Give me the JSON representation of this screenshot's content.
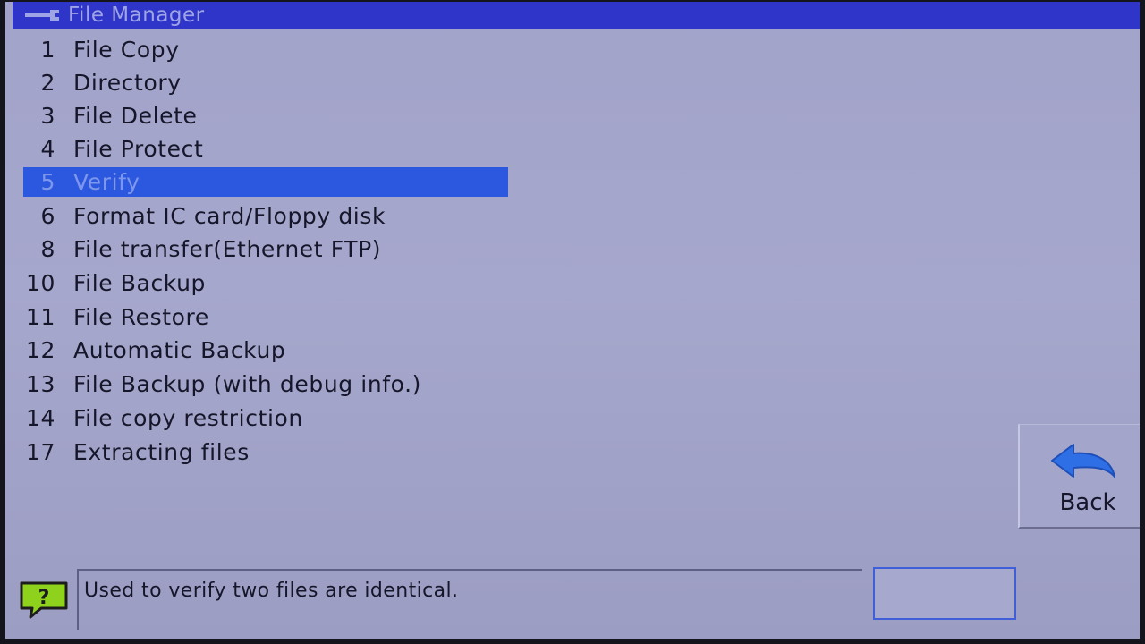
{
  "window": {
    "title": "File Manager",
    "icon": "wrench-icon"
  },
  "menu": {
    "items": [
      {
        "num": "1",
        "label": "File Copy",
        "selected": false
      },
      {
        "num": "2",
        "label": "Directory",
        "selected": false
      },
      {
        "num": "3",
        "label": "File Delete",
        "selected": false
      },
      {
        "num": "4",
        "label": "File Protect",
        "selected": false
      },
      {
        "num": "5",
        "label": "Verify",
        "selected": true
      },
      {
        "num": "6",
        "label": "Format IC card/Floppy disk",
        "selected": false
      },
      {
        "num": "8",
        "label": "File transfer(Ethernet FTP)",
        "selected": false
      },
      {
        "num": "10",
        "label": "File Backup",
        "selected": false
      },
      {
        "num": "11",
        "label": "File Restore",
        "selected": false
      },
      {
        "num": "12",
        "label": "Automatic Backup",
        "selected": false
      },
      {
        "num": "13",
        "label": "File Backup (with debug info.)",
        "selected": false
      },
      {
        "num": "14",
        "label": "File copy restriction",
        "selected": false
      },
      {
        "num": "17",
        "label": "Extracting files",
        "selected": false
      }
    ]
  },
  "back_button": {
    "label": "Back",
    "icon": "back-arrow-icon"
  },
  "help": {
    "icon": "help-question-icon",
    "message": "Used to verify two files are identical."
  },
  "colors": {
    "title_bar": "#2f35c8",
    "selection": "#2c58e0",
    "background": "#a2a3ca",
    "back_arrow": "#2f6fe6",
    "help_icon": "#8fd21e"
  }
}
